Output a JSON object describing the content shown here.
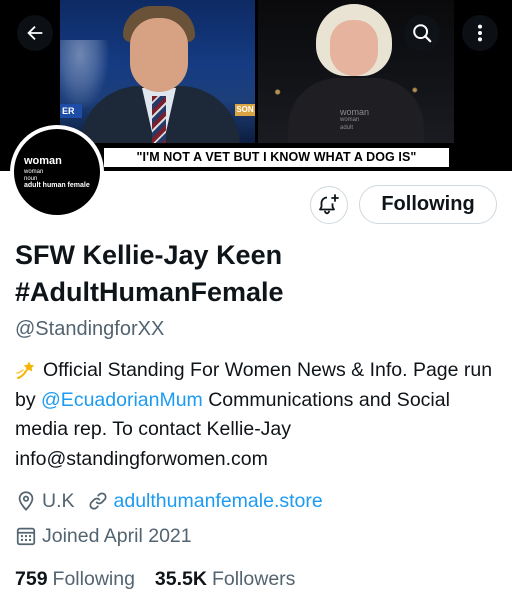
{
  "banner": {
    "quote": "\"I'M NOT A VET BUT I KNOW WHAT A DOG IS\"",
    "left_lower_third_left": "ER",
    "left_lower_third_right": "SON",
    "shirt_lines": [
      "woman",
      "woman",
      "adult"
    ]
  },
  "nav": {
    "back_icon": "arrow-left-icon",
    "search_icon": "search-icon",
    "more_icon": "more-vertical-icon"
  },
  "avatar": {
    "lines": [
      "woman",
      "woman",
      "noun",
      "adult human female"
    ]
  },
  "actions": {
    "notify_icon": "bell-plus-icon",
    "following_label": "Following"
  },
  "profile": {
    "display_name": "SFW Kellie-Jay Keen #AdultHumanFemale",
    "handle": "@StandingforXX",
    "bio_emoji_icon": "dizzy-star-icon",
    "bio_part1": "Official Standing For Women News & Info. Page run by ",
    "bio_mention": "@EcuadorianMum",
    "bio_part2": " Communications and Social media rep. To contact Kellie-Jay info@standingforwomen.com",
    "location": "U.K",
    "website": "adulthumanfemale.store",
    "joined": "Joined April 2021"
  },
  "stats": {
    "following_count": "759",
    "following_label": "Following",
    "followers_count": "35.5K",
    "followers_label": "Followers"
  },
  "colors": {
    "accent": "#1d9bf0",
    "text_primary": "#0f1419",
    "text_secondary": "#536471",
    "border": "#cfd9de"
  }
}
